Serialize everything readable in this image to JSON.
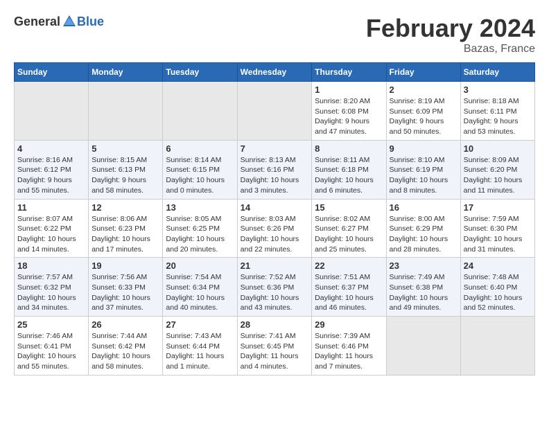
{
  "logo": {
    "general": "General",
    "blue": "Blue"
  },
  "title": "February 2024",
  "subtitle": "Bazas, France",
  "days_header": [
    "Sunday",
    "Monday",
    "Tuesday",
    "Wednesday",
    "Thursday",
    "Friday",
    "Saturday"
  ],
  "weeks": [
    [
      {
        "num": "",
        "info": "",
        "empty": true
      },
      {
        "num": "",
        "info": "",
        "empty": true
      },
      {
        "num": "",
        "info": "",
        "empty": true
      },
      {
        "num": "",
        "info": "",
        "empty": true
      },
      {
        "num": "1",
        "info": "Sunrise: 8:20 AM\nSunset: 6:08 PM\nDaylight: 9 hours and 47 minutes.",
        "empty": false
      },
      {
        "num": "2",
        "info": "Sunrise: 8:19 AM\nSunset: 6:09 PM\nDaylight: 9 hours and 50 minutes.",
        "empty": false
      },
      {
        "num": "3",
        "info": "Sunrise: 8:18 AM\nSunset: 6:11 PM\nDaylight: 9 hours and 53 minutes.",
        "empty": false
      }
    ],
    [
      {
        "num": "4",
        "info": "Sunrise: 8:16 AM\nSunset: 6:12 PM\nDaylight: 9 hours and 55 minutes.",
        "empty": false
      },
      {
        "num": "5",
        "info": "Sunrise: 8:15 AM\nSunset: 6:13 PM\nDaylight: 9 hours and 58 minutes.",
        "empty": false
      },
      {
        "num": "6",
        "info": "Sunrise: 8:14 AM\nSunset: 6:15 PM\nDaylight: 10 hours and 0 minutes.",
        "empty": false
      },
      {
        "num": "7",
        "info": "Sunrise: 8:13 AM\nSunset: 6:16 PM\nDaylight: 10 hours and 3 minutes.",
        "empty": false
      },
      {
        "num": "8",
        "info": "Sunrise: 8:11 AM\nSunset: 6:18 PM\nDaylight: 10 hours and 6 minutes.",
        "empty": false
      },
      {
        "num": "9",
        "info": "Sunrise: 8:10 AM\nSunset: 6:19 PM\nDaylight: 10 hours and 8 minutes.",
        "empty": false
      },
      {
        "num": "10",
        "info": "Sunrise: 8:09 AM\nSunset: 6:20 PM\nDaylight: 10 hours and 11 minutes.",
        "empty": false
      }
    ],
    [
      {
        "num": "11",
        "info": "Sunrise: 8:07 AM\nSunset: 6:22 PM\nDaylight: 10 hours and 14 minutes.",
        "empty": false
      },
      {
        "num": "12",
        "info": "Sunrise: 8:06 AM\nSunset: 6:23 PM\nDaylight: 10 hours and 17 minutes.",
        "empty": false
      },
      {
        "num": "13",
        "info": "Sunrise: 8:05 AM\nSunset: 6:25 PM\nDaylight: 10 hours and 20 minutes.",
        "empty": false
      },
      {
        "num": "14",
        "info": "Sunrise: 8:03 AM\nSunset: 6:26 PM\nDaylight: 10 hours and 22 minutes.",
        "empty": false
      },
      {
        "num": "15",
        "info": "Sunrise: 8:02 AM\nSunset: 6:27 PM\nDaylight: 10 hours and 25 minutes.",
        "empty": false
      },
      {
        "num": "16",
        "info": "Sunrise: 8:00 AM\nSunset: 6:29 PM\nDaylight: 10 hours and 28 minutes.",
        "empty": false
      },
      {
        "num": "17",
        "info": "Sunrise: 7:59 AM\nSunset: 6:30 PM\nDaylight: 10 hours and 31 minutes.",
        "empty": false
      }
    ],
    [
      {
        "num": "18",
        "info": "Sunrise: 7:57 AM\nSunset: 6:32 PM\nDaylight: 10 hours and 34 minutes.",
        "empty": false
      },
      {
        "num": "19",
        "info": "Sunrise: 7:56 AM\nSunset: 6:33 PM\nDaylight: 10 hours and 37 minutes.",
        "empty": false
      },
      {
        "num": "20",
        "info": "Sunrise: 7:54 AM\nSunset: 6:34 PM\nDaylight: 10 hours and 40 minutes.",
        "empty": false
      },
      {
        "num": "21",
        "info": "Sunrise: 7:52 AM\nSunset: 6:36 PM\nDaylight: 10 hours and 43 minutes.",
        "empty": false
      },
      {
        "num": "22",
        "info": "Sunrise: 7:51 AM\nSunset: 6:37 PM\nDaylight: 10 hours and 46 minutes.",
        "empty": false
      },
      {
        "num": "23",
        "info": "Sunrise: 7:49 AM\nSunset: 6:38 PM\nDaylight: 10 hours and 49 minutes.",
        "empty": false
      },
      {
        "num": "24",
        "info": "Sunrise: 7:48 AM\nSunset: 6:40 PM\nDaylight: 10 hours and 52 minutes.",
        "empty": false
      }
    ],
    [
      {
        "num": "25",
        "info": "Sunrise: 7:46 AM\nSunset: 6:41 PM\nDaylight: 10 hours and 55 minutes.",
        "empty": false
      },
      {
        "num": "26",
        "info": "Sunrise: 7:44 AM\nSunset: 6:42 PM\nDaylight: 10 hours and 58 minutes.",
        "empty": false
      },
      {
        "num": "27",
        "info": "Sunrise: 7:43 AM\nSunset: 6:44 PM\nDaylight: 11 hours and 1 minute.",
        "empty": false
      },
      {
        "num": "28",
        "info": "Sunrise: 7:41 AM\nSunset: 6:45 PM\nDaylight: 11 hours and 4 minutes.",
        "empty": false
      },
      {
        "num": "29",
        "info": "Sunrise: 7:39 AM\nSunset: 6:46 PM\nDaylight: 11 hours and 7 minutes.",
        "empty": false
      },
      {
        "num": "",
        "info": "",
        "empty": true
      },
      {
        "num": "",
        "info": "",
        "empty": true
      }
    ]
  ]
}
